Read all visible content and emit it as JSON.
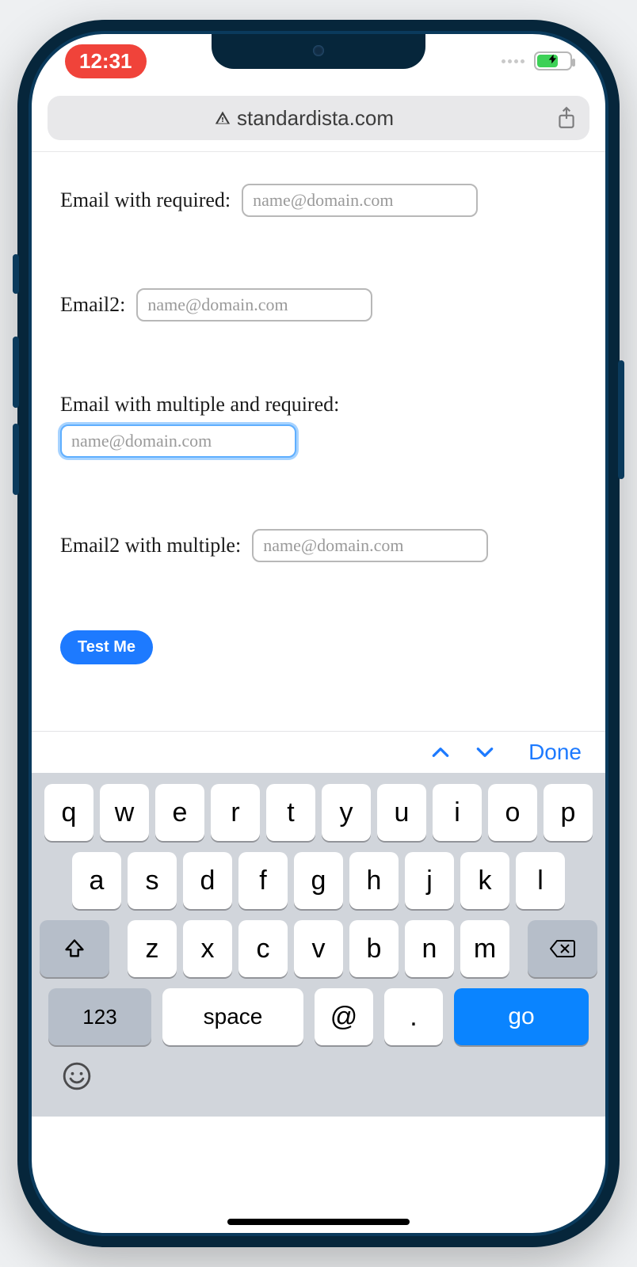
{
  "status": {
    "time": "12:31"
  },
  "browser": {
    "domain": "standardista.com"
  },
  "form": {
    "fields": [
      {
        "label": "Email with required:",
        "placeholder": "name@domain.com",
        "focused": false
      },
      {
        "label": "Email2:",
        "placeholder": "name@domain.com",
        "focused": false
      },
      {
        "label": "Email with multiple and required:",
        "placeholder": "name@domain.com",
        "focused": true
      },
      {
        "label": "Email2 with multiple:",
        "placeholder": "name@domain.com",
        "focused": false
      }
    ],
    "submit_label": "Test Me"
  },
  "keyboard_accessory": {
    "done_label": "Done"
  },
  "keyboard": {
    "row1": [
      "q",
      "w",
      "e",
      "r",
      "t",
      "y",
      "u",
      "i",
      "o",
      "p"
    ],
    "row2": [
      "a",
      "s",
      "d",
      "f",
      "g",
      "h",
      "j",
      "k",
      "l"
    ],
    "row3": [
      "z",
      "x",
      "c",
      "v",
      "b",
      "n",
      "m"
    ],
    "num_key": "123",
    "space_key": "space",
    "at_key": "@",
    "dot_key": ".",
    "go_key": "go"
  }
}
